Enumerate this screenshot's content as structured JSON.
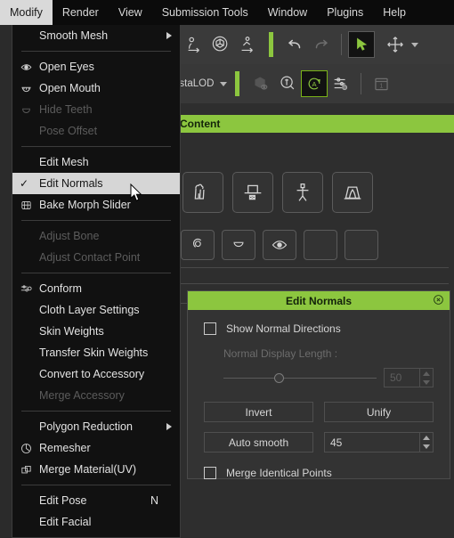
{
  "menubar": {
    "items": [
      {
        "label": "Modify",
        "active": true
      },
      {
        "label": "Render",
        "active": false
      },
      {
        "label": "View",
        "active": false
      },
      {
        "label": "Submission Tools",
        "active": false
      },
      {
        "label": "Window",
        "active": false
      },
      {
        "label": "Plugins",
        "active": false
      },
      {
        "label": "Help",
        "active": false
      }
    ]
  },
  "dropdown": {
    "title": "Modify",
    "items": [
      {
        "label": "Smooth Mesh",
        "icon": "",
        "submenu": true,
        "disabled": false,
        "checked": false,
        "shortcut": ""
      },
      {
        "separator": true
      },
      {
        "label": "Open Eyes",
        "icon": "eye-icon",
        "submenu": false,
        "disabled": false,
        "checked": false,
        "shortcut": ""
      },
      {
        "label": "Open Mouth",
        "icon": "open-mouth-icon",
        "submenu": false,
        "disabled": false,
        "checked": false,
        "shortcut": ""
      },
      {
        "label": "Hide Teeth",
        "icon": "teeth-icon",
        "submenu": false,
        "disabled": true,
        "checked": false,
        "shortcut": ""
      },
      {
        "label": "Pose Offset",
        "icon": "",
        "submenu": false,
        "disabled": true,
        "checked": false,
        "shortcut": ""
      },
      {
        "separator": true
      },
      {
        "label": "Edit Mesh",
        "icon": "",
        "submenu": false,
        "disabled": false,
        "checked": false,
        "shortcut": ""
      },
      {
        "label": "Edit Normals",
        "icon": "",
        "submenu": false,
        "disabled": false,
        "checked": true,
        "selected": true,
        "shortcut": ""
      },
      {
        "label": "Bake Morph Slider",
        "icon": "bake-morph-icon",
        "submenu": false,
        "disabled": false,
        "checked": false,
        "shortcut": ""
      },
      {
        "separator": true
      },
      {
        "label": "Adjust Bone",
        "icon": "",
        "submenu": false,
        "disabled": true,
        "checked": false,
        "shortcut": ""
      },
      {
        "label": "Adjust Contact Point",
        "icon": "",
        "submenu": false,
        "disabled": true,
        "checked": false,
        "shortcut": ""
      },
      {
        "separator": true
      },
      {
        "label": "Conform",
        "icon": "conform-icon",
        "submenu": false,
        "disabled": false,
        "checked": false,
        "shortcut": ""
      },
      {
        "label": "Cloth Layer Settings",
        "icon": "",
        "submenu": false,
        "disabled": false,
        "checked": false,
        "shortcut": ""
      },
      {
        "label": "Skin Weights",
        "icon": "",
        "submenu": false,
        "disabled": false,
        "checked": false,
        "shortcut": ""
      },
      {
        "label": "Transfer Skin Weights",
        "icon": "",
        "submenu": false,
        "disabled": false,
        "checked": false,
        "shortcut": ""
      },
      {
        "label": "Convert to Accessory",
        "icon": "",
        "submenu": false,
        "disabled": false,
        "checked": false,
        "shortcut": ""
      },
      {
        "label": "Merge Accessory",
        "icon": "",
        "submenu": false,
        "disabled": true,
        "checked": false,
        "shortcut": ""
      },
      {
        "separator": true
      },
      {
        "label": "Polygon Reduction",
        "icon": "",
        "submenu": true,
        "disabled": false,
        "checked": false,
        "shortcut": ""
      },
      {
        "label": "Remesher",
        "icon": "remesher-icon",
        "submenu": false,
        "disabled": false,
        "checked": false,
        "shortcut": ""
      },
      {
        "label": "Merge Material(UV)",
        "icon": "merge-material-icon",
        "submenu": false,
        "disabled": false,
        "checked": false,
        "shortcut": ""
      },
      {
        "separator": true
      },
      {
        "label": "Edit Pose",
        "icon": "",
        "submenu": false,
        "disabled": false,
        "checked": false,
        "shortcut": "N"
      },
      {
        "label": "Edit Facial",
        "icon": "",
        "submenu": false,
        "disabled": false,
        "checked": false,
        "shortcut": ""
      }
    ]
  },
  "toolbar": {
    "row1_icons": [
      "pose-offset-icon",
      "object-transform-icon",
      "animation-transform-icon"
    ],
    "undo_icon": "undo-icon",
    "redo_icon": "redo-icon",
    "select_icon": "select-arrow-icon",
    "move_icon": "move-tool-icon",
    "row2_label": "nstaLOD",
    "row2_icons": [
      "hide-object-icon",
      "zoom-select-icon",
      "auto-rotate-icon",
      "settings-sliders-icon",
      "explorer-icon"
    ]
  },
  "content_header": {
    "title": "Content"
  },
  "content_panel": {
    "row1_icons": [
      "cloth-preset-icon",
      "hat-preset-icon",
      "figure-preset-icon",
      "stage-preset-icon"
    ],
    "row2_icons": [
      "hair-preset-icon",
      "teeth-preset-icon",
      "eye-preset-icon",
      "blank-preset-icon",
      "blank2-preset-icon"
    ]
  },
  "edit_normals_panel": {
    "title": "Edit Normals",
    "close_icon": "close-circle-icon",
    "show_normal_directions": {
      "label": "Show Normal Directions",
      "checked": false
    },
    "normal_display_length": {
      "label": "Normal Display Length :",
      "value": "50",
      "disabled": true,
      "slider_percent": 33
    },
    "invert_button": "Invert",
    "unify_button": "Unify",
    "auto_smooth_button": "Auto smooth",
    "angle_value": "45",
    "merge_identical_points": {
      "label": "Merge Identical Points",
      "checked": false
    }
  },
  "colors": {
    "accent_green": "#8cc63f",
    "menu_bg": "#111111",
    "panel_bg": "#333333",
    "app_bg": "#2e2e2e",
    "highlight": "#d6d6d6"
  }
}
